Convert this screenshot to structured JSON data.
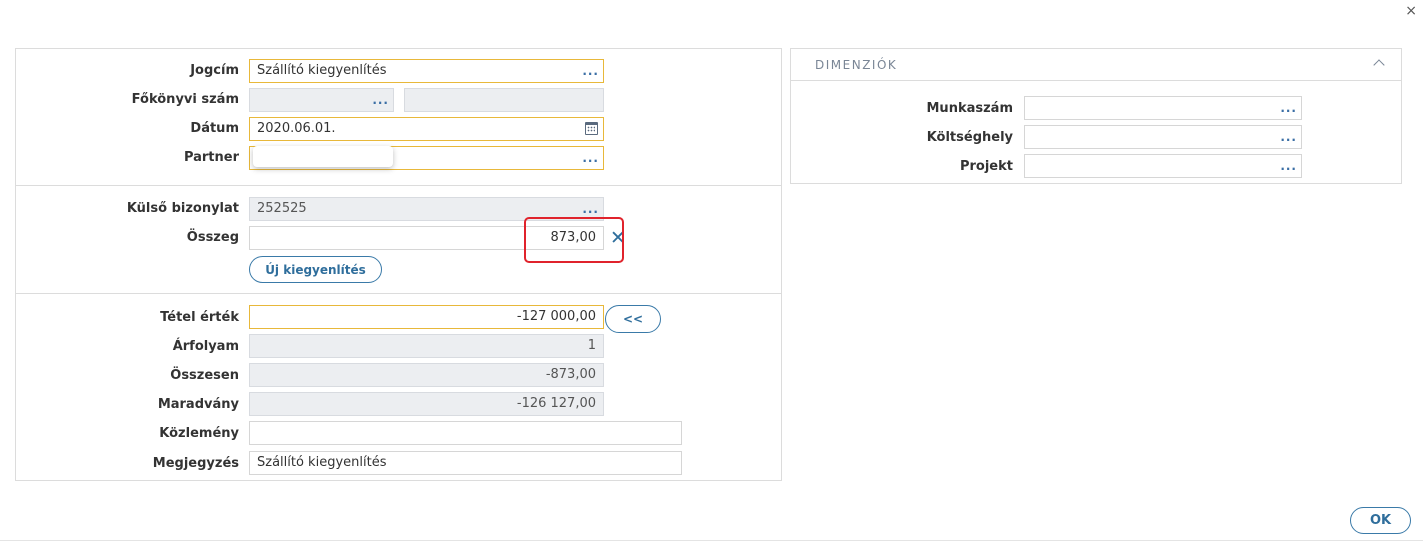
{
  "window": {
    "close_symbol": "×"
  },
  "form": {
    "jogcim": {
      "label": "Jogcím",
      "value": "Szállító kiegyenlítés"
    },
    "fokonyvi": {
      "label": "Főkönyvi szám",
      "value": "",
      "value2": ""
    },
    "datum": {
      "label": "Dátum",
      "value": "2020.06.01."
    },
    "partner": {
      "label": "Partner",
      "value": ""
    },
    "kulso": {
      "label": "Külső bizonylat",
      "value": "252525"
    },
    "osszeg": {
      "label": "Összeg",
      "value": "873,00",
      "clear_symbol": "✕"
    },
    "uj_button": "Új kiegyenlítés",
    "tetel": {
      "label": "Tétel érték",
      "value": "-127 000,00",
      "button": "<<"
    },
    "arfolyam": {
      "label": "Árfolyam",
      "value": "1"
    },
    "osszesen": {
      "label": "Összesen",
      "value": "-873,00"
    },
    "maradvany": {
      "label": "Maradvány",
      "value": "-126 127,00"
    },
    "kozlemeny": {
      "label": "Közlemény",
      "value": ""
    },
    "megjegyzes": {
      "label": "Megjegyzés",
      "value": "Szállító kiegyenlítés"
    }
  },
  "dimensions": {
    "title": "DIMENZIÓK",
    "munkaszam": {
      "label": "Munkaszám",
      "value": ""
    },
    "koltseghely": {
      "label": "Költséghely",
      "value": ""
    },
    "projekt": {
      "label": "Projekt",
      "value": ""
    }
  },
  "footer": {
    "ok_button": "OK"
  },
  "icons": {
    "dots": "...",
    "lookup": "ellipsis-icon",
    "calendar": "calendar-icon",
    "collapse": "chevron-up-icon"
  },
  "colors": {
    "required_border": "#e8b83a",
    "readonly_bg": "#eceef1",
    "accent": "#2f6e9c",
    "highlight": "#e0232c"
  }
}
